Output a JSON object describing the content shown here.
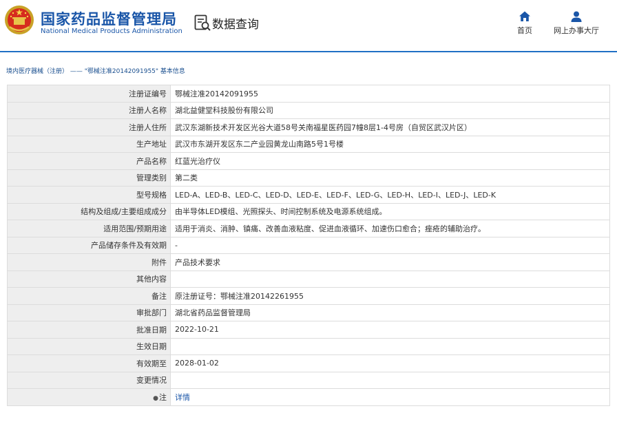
{
  "header": {
    "logo_cn": "国家药品监督管理局",
    "logo_en": "National Medical Products Administration",
    "section_title": "数据查询",
    "nav": {
      "home_label": "首页",
      "hall_label": "网上办事大厅"
    }
  },
  "breadcrumb": {
    "root": "境内医疗器械（注册）",
    "separator": "——",
    "current": "\"鄂械注准20142091955\"  基本信息"
  },
  "details": {
    "rows": [
      {
        "label": "注册证编号",
        "value": "鄂械注准20142091955"
      },
      {
        "label": "注册人名称",
        "value": "湖北益健堂科技股份有限公司"
      },
      {
        "label": "注册人住所",
        "value": "武汉东湖新技术开发区光谷大道58号关南福星医药园7幢8层1-4号房（自贸区武汉片区）"
      },
      {
        "label": "生产地址",
        "value": "武汉市东湖开发区东二产业园黄龙山南路5号1号楼"
      },
      {
        "label": "产品名称",
        "value": "红蓝光治疗仪"
      },
      {
        "label": "管理类别",
        "value": "第二类"
      },
      {
        "label": "型号规格",
        "value": "LED-A、LED-B、LED-C、LED-D、LED-E、LED-F、LED-G、LED-H、LED-I、LED-J、LED-K"
      },
      {
        "label": "结构及组成/主要组成成分",
        "value": "由半导体LED模组、光照探头、时间控制系统及电源系统组成。"
      },
      {
        "label": "适用范围/预期用途",
        "value": "适用于消炎、消肿、镇痛、改善血液粘度、促进血液循环、加速伤口愈合；痤疮的辅助治疗。"
      },
      {
        "label": "产品储存条件及有效期",
        "value": "-"
      },
      {
        "label": "附件",
        "value": "产品技术要求"
      },
      {
        "label": "其他内容",
        "value": ""
      },
      {
        "label": "备注",
        "value": "原注册证号：鄂械注准20142261955"
      },
      {
        "label": "审批部门",
        "value": "湖北省药品监督管理局"
      },
      {
        "label": "批准日期",
        "value": "2022-10-21"
      },
      {
        "label": "生效日期",
        "value": ""
      },
      {
        "label": "有效期至",
        "value": "2028-01-02"
      },
      {
        "label": "变更情况",
        "value": ""
      }
    ],
    "note": {
      "label": "注",
      "link": "详情"
    }
  },
  "colors": {
    "brand_blue": "#1a56a8",
    "rule_blue": "#1f6fc4",
    "label_bg": "#eeeeee",
    "border": "#dcdcdc"
  },
  "icons": {
    "emblem": "national-emblem-icon",
    "query": "document-search-icon",
    "home": "home-icon",
    "hall": "user-icon",
    "note": "marker-icon"
  }
}
